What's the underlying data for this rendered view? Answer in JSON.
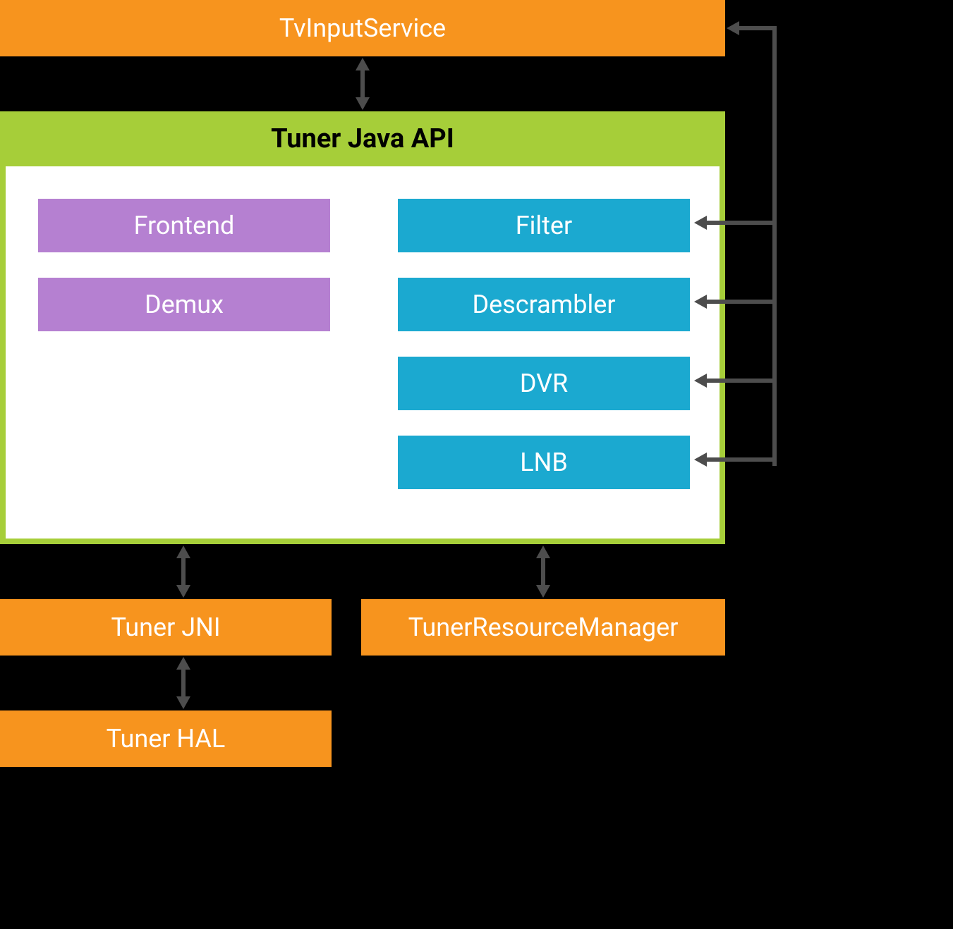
{
  "top_box": "TvInputService",
  "green_header": "Tuner Java API",
  "left_col": {
    "frontend": "Frontend",
    "demux": "Demux"
  },
  "right_col": {
    "filter": "Filter",
    "descrambler": "Descrambler",
    "dvr": "DVR",
    "lnb": "LNB"
  },
  "bottom": {
    "tuner_jni": "Tuner JNI",
    "tuner_resource_manager": "TunerResourceManager",
    "tuner_hal": "Tuner HAL"
  }
}
